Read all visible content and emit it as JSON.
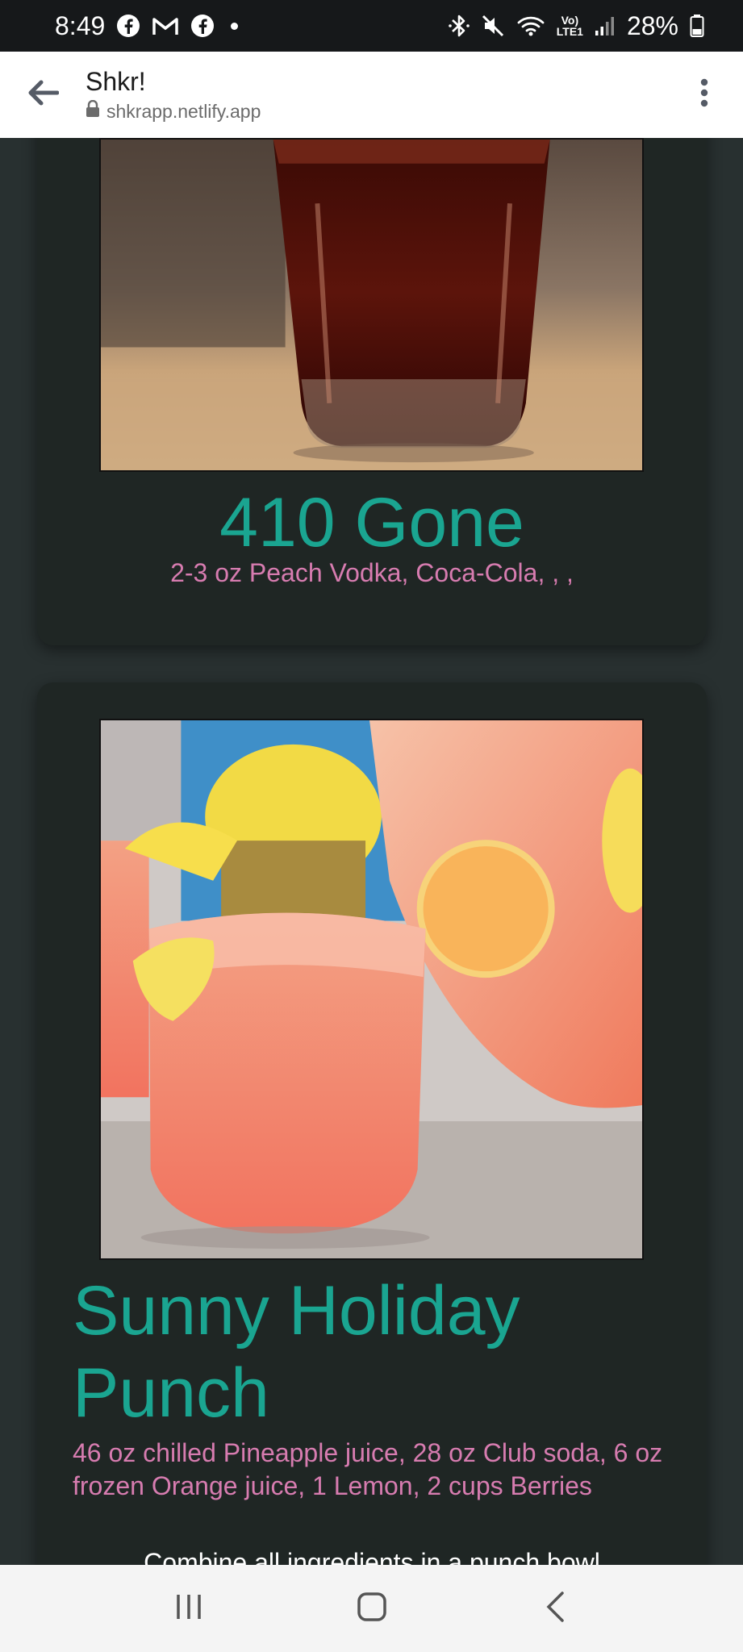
{
  "status_bar": {
    "time": "8:49",
    "left_icons": [
      "facebook-icon",
      "gmail-icon",
      "facebook-icon"
    ],
    "volte_top": "Vo)",
    "volte_bottom": "LTE1",
    "battery": "28%"
  },
  "browser": {
    "title": "Shkr!",
    "url": "shkrapp.netlify.app"
  },
  "drinks": [
    {
      "name": "410 Gone",
      "ingredients": "2-3 oz Peach Vodka, Coca-Cola, , ,"
    },
    {
      "name": "Sunny Holiday Punch",
      "ingredients": "46 oz chilled Pineapple juice, 28 oz Club soda, 6 oz frozen Orange juice, 1 Lemon, 2 cups Berries",
      "instructions": "Combine all ingredients in a punch bowl"
    }
  ],
  "colors": {
    "background": "#283030",
    "card": "#1f2624",
    "title_teal": "#1aa591",
    "ingredients_pink": "#d77cb0"
  }
}
